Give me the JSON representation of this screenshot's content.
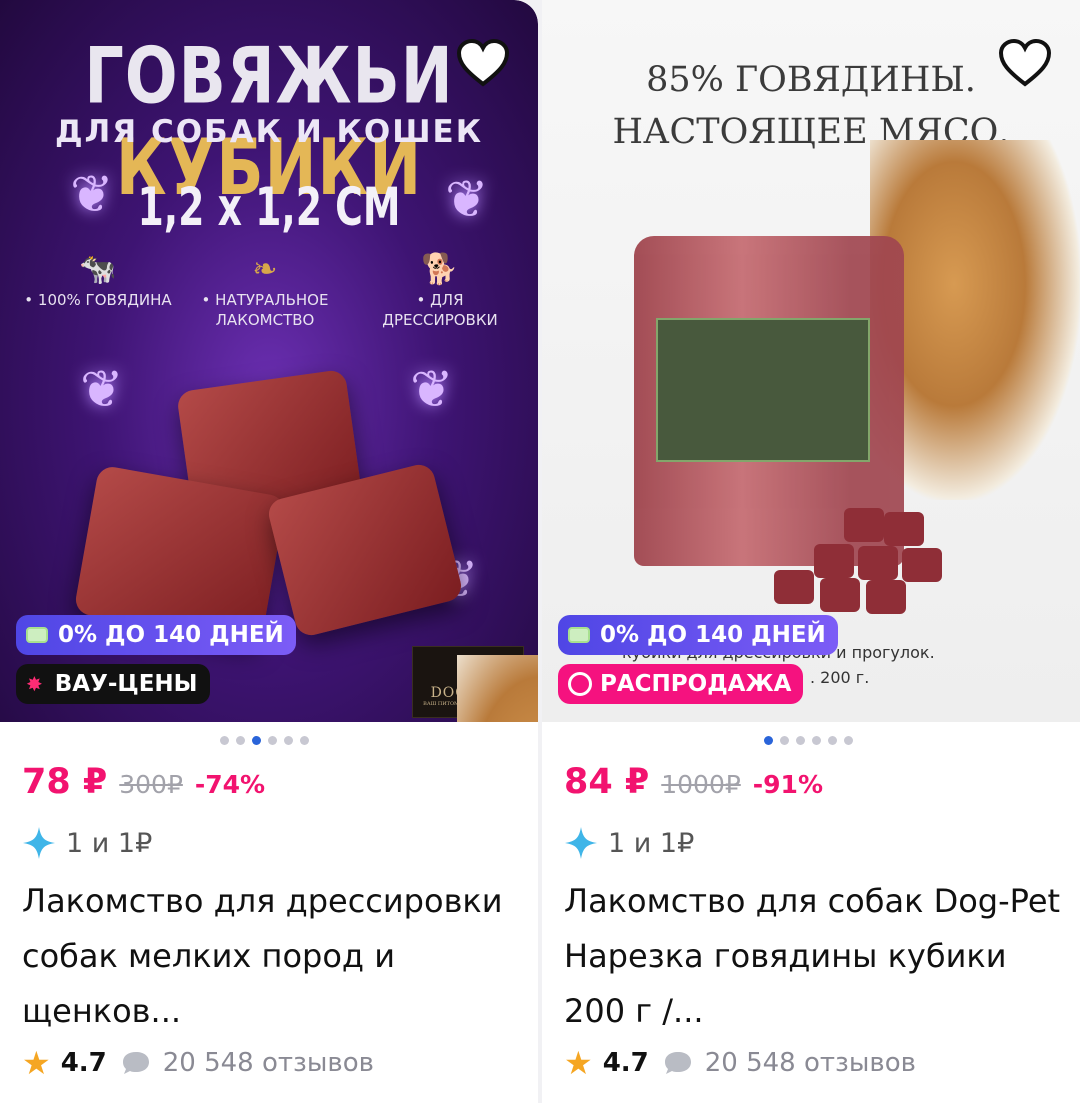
{
  "products": [
    {
      "image": {
        "title_white": "ГОВЯЖЬИ ",
        "title_gold": "КУБИКИ",
        "subtitle": "ДЛЯ СОБАК И КОШЕК",
        "size": "1,2 x 1,2 СМ",
        "features": [
          {
            "icon": "cow-icon",
            "text": "• 100% ГОВЯДИНА"
          },
          {
            "icon": "leaf-icon",
            "text": "• НАТУРАЛЬНОЕ ЛАКОМСТВО"
          },
          {
            "icon": "dog-icon",
            "text": "• ДЛЯ ДРЕССИРОВКИ"
          }
        ],
        "logo": "DOG-PET",
        "logo_sub": "ВАШ ПИТОМЕЦ НАША СТРАСТЬ"
      },
      "badges": {
        "installment": "0% ДО 140 ДНЕЙ",
        "promo": "ВАУ-ЦЕНЫ"
      },
      "carousel": {
        "count": 6,
        "active": 2
      },
      "price": "78 ₽",
      "old_price": "300₽",
      "discount": "-74%",
      "bonus": "1 и 1₽",
      "title": "Лакомство для дрессировки собак мелких пород и щенков...",
      "rating": "4.7",
      "reviews": "20 548 отзывов"
    },
    {
      "image": {
        "headline_1": "85% ГОВЯДИНЫ.",
        "headline_2": "НАСТОЯЩЕЕ МЯСО.",
        "caption_1": "кубики для дрессировки и прогулок.",
        "caption_2": ". 200 г."
      },
      "badges": {
        "installment": "0% ДО 140 ДНЕЙ",
        "promo": "РАСПРОДАЖА"
      },
      "carousel": {
        "count": 6,
        "active": 0
      },
      "price": "84 ₽",
      "old_price": "1000₽",
      "discount": "-91%",
      "bonus": "1 и 1₽",
      "title": "Лакомство для собак Dog-Pet Нарезка говядины кубики 200 г /...",
      "rating": "4.7",
      "reviews": "20 548 отзывов"
    }
  ],
  "colors": {
    "price": "#f2136f",
    "installment_badge": "#5b4ef0",
    "sale_badge": "#f5127f",
    "dot_active": "#2a64d9"
  }
}
